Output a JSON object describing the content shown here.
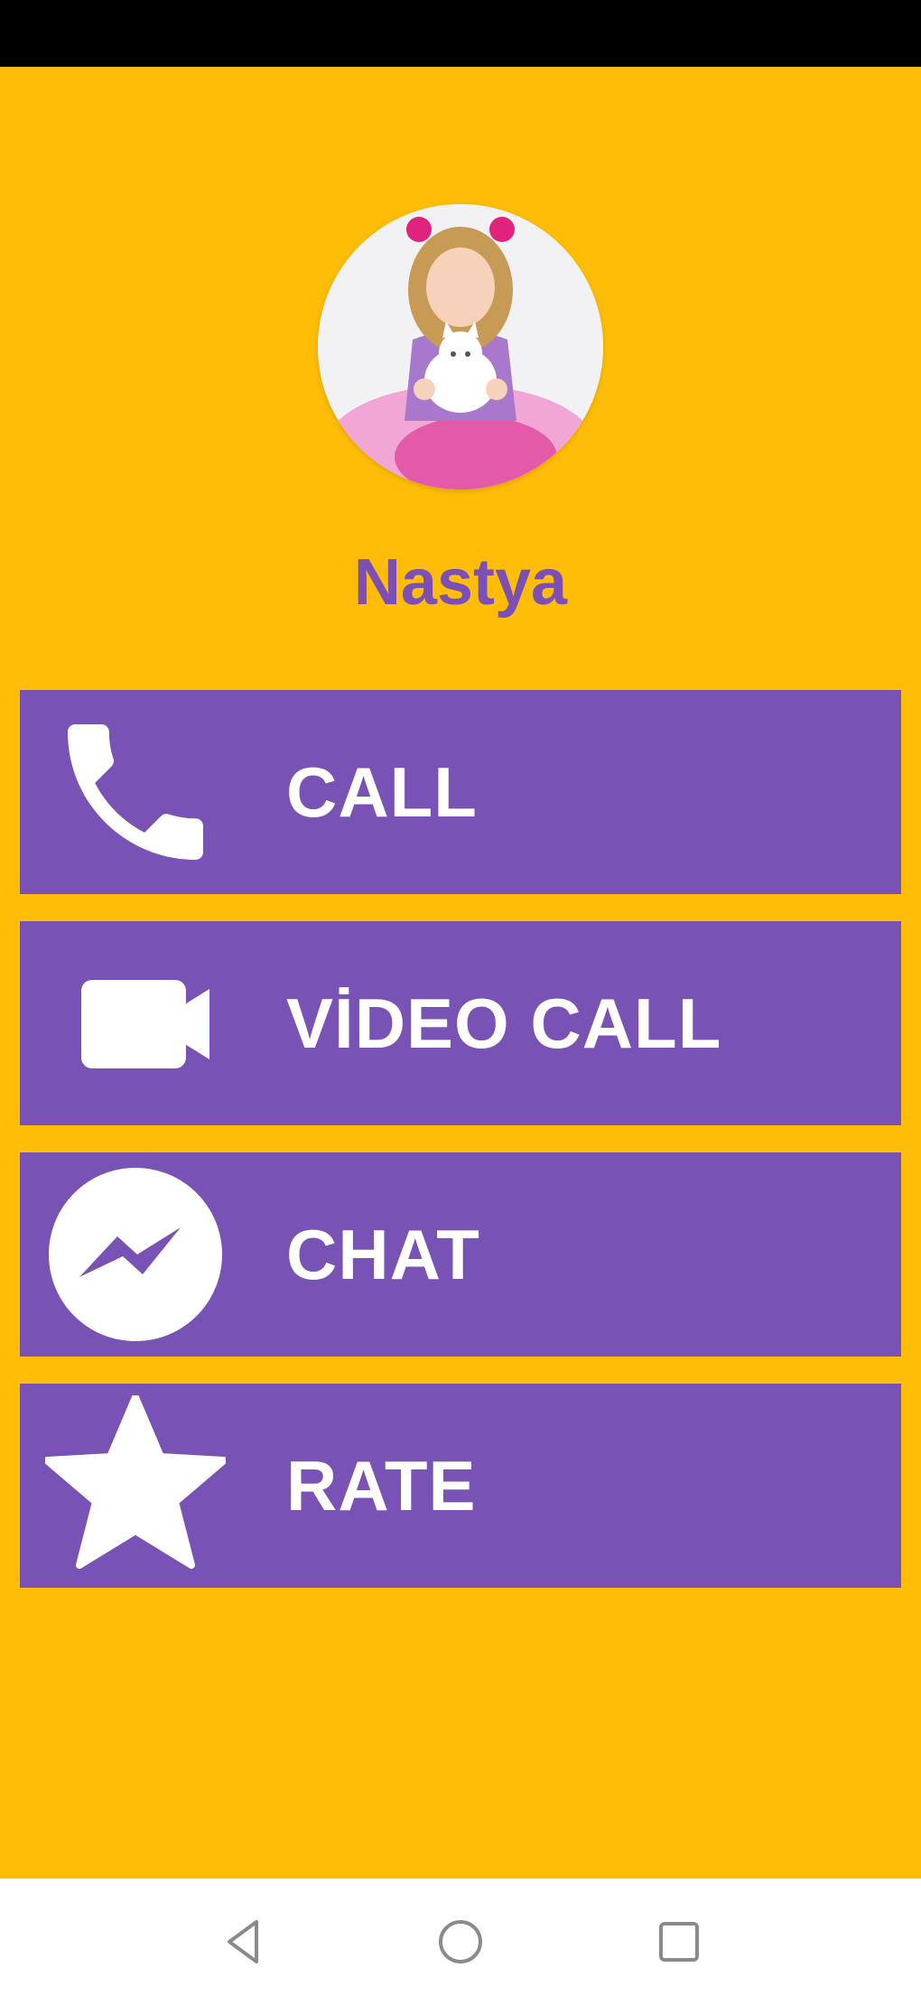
{
  "contact": {
    "name": "Nastya"
  },
  "buttons": {
    "call": {
      "label": "CALL",
      "icon": "phone-icon"
    },
    "video_call": {
      "label": "VİDEO CALL",
      "icon": "video-camera-icon"
    },
    "chat": {
      "label": "CHAT",
      "icon": "messenger-icon"
    },
    "rate": {
      "label": "RATE",
      "icon": "star-icon"
    }
  },
  "nav": {
    "back": "back-triangle-icon",
    "home": "home-circle-icon",
    "recents": "recents-square-icon"
  },
  "colors": {
    "background": "#FFBD08",
    "button": "#7852B4",
    "name_text": "#7B4FB3",
    "button_text": "#FFFFFF"
  }
}
